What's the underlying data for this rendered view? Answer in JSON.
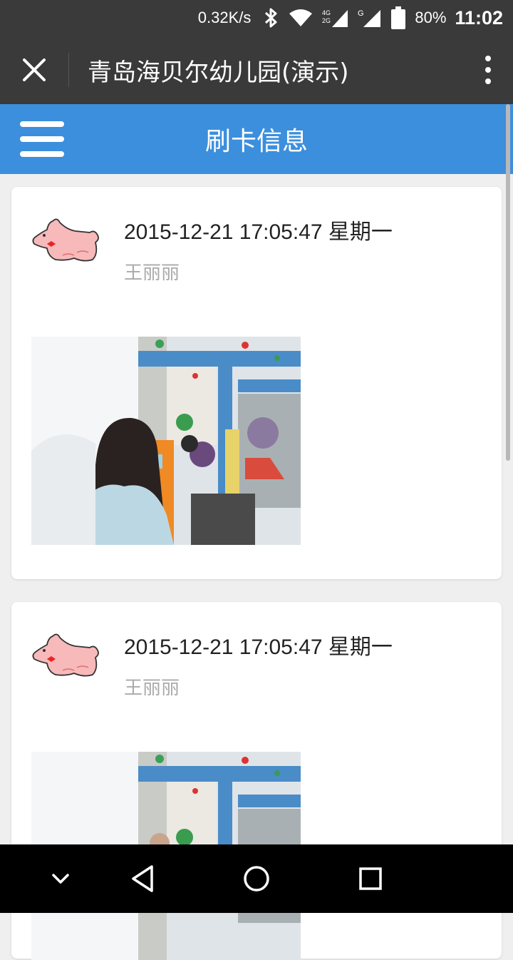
{
  "status_bar": {
    "net_speed": "0.32K/s",
    "network_4g_label": "4G",
    "network_2g_label": "2G",
    "network_g_label": "G",
    "battery": "80%",
    "time": "11:02"
  },
  "title_bar": {
    "title": "青岛海贝尔幼儿园(演示)"
  },
  "app_header": {
    "title": "刷卡信息"
  },
  "records": [
    {
      "datetime": "2015-12-21 17:05:47  星期一",
      "name": "王丽丽"
    },
    {
      "datetime": "2015-12-21 17:05:47  星期一",
      "name": "王丽丽"
    }
  ],
  "colors": {
    "header_blue": "#3c8fdc",
    "title_bar_bg": "#3a3a3a",
    "page_bg": "#efefef"
  },
  "icons": {
    "close": "close-icon",
    "more": "more-vertical-icon",
    "menu": "hamburger-menu-icon",
    "avatar": "pink-dog-icon",
    "nav_down": "chevron-down-icon",
    "nav_back": "back-triangle-icon",
    "nav_home": "home-circle-icon",
    "nav_recents": "recents-square-icon"
  }
}
